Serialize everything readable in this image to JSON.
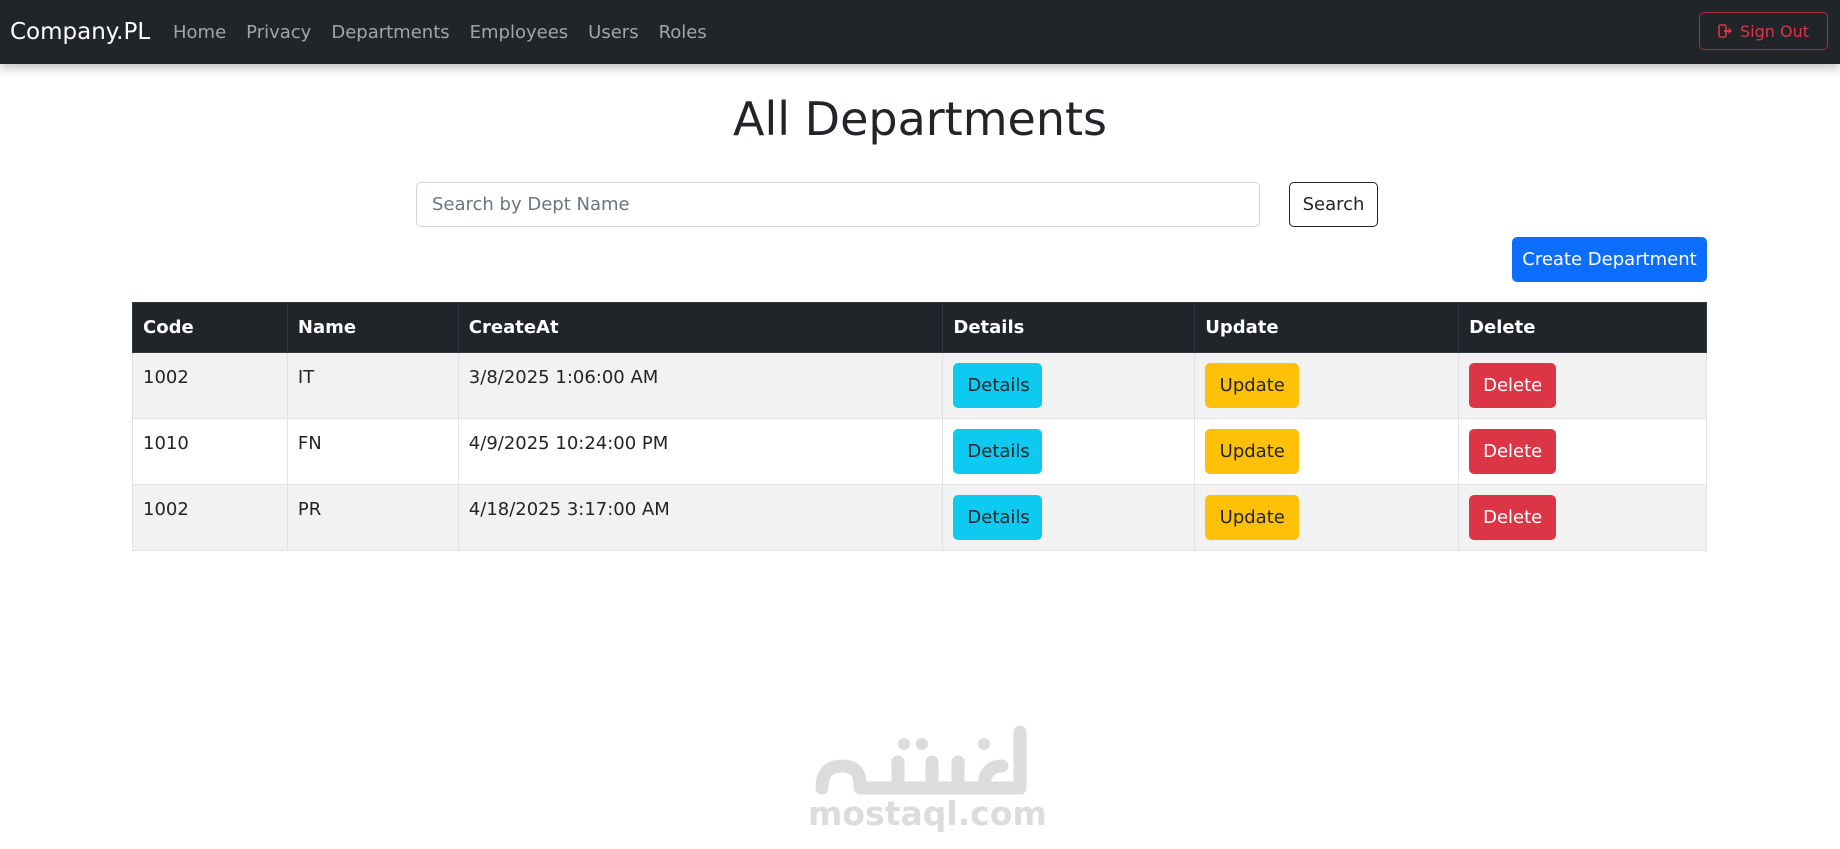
{
  "navbar": {
    "brand": "Company.PL",
    "links": [
      "Home",
      "Privacy",
      "Departments",
      "Employees",
      "Users",
      "Roles"
    ],
    "signout_label": "Sign Out",
    "signout_icon": "sign-out-icon"
  },
  "page": {
    "title": "All Departments"
  },
  "search": {
    "placeholder": "Search by Dept Name",
    "value": "",
    "button_label": "Search"
  },
  "create_button_label": "Create Department",
  "table": {
    "headers": [
      "Code",
      "Name",
      "CreateAt",
      "Details",
      "Update",
      "Delete"
    ],
    "rows": [
      {
        "code": "1002",
        "name": "IT",
        "create_at": "3/8/2025 1:06:00 AM",
        "details_label": "Details",
        "update_label": "Update",
        "delete_label": "Delete"
      },
      {
        "code": "1010",
        "name": "FN",
        "create_at": "4/9/2025 10:24:00 PM",
        "details_label": "Details",
        "update_label": "Update",
        "delete_label": "Delete"
      },
      {
        "code": "1002",
        "name": "PR",
        "create_at": "4/18/2025 3:17:00 AM",
        "details_label": "Details",
        "update_label": "Update",
        "delete_label": "Delete"
      }
    ]
  },
  "watermark": {
    "text": "mostaql.com",
    "logo_text": "مستقل"
  },
  "colors": {
    "navbar_bg": "#212529",
    "primary": "#0d6efd",
    "info": "#0dcaf0",
    "warning": "#ffc107",
    "danger": "#dc3545"
  }
}
